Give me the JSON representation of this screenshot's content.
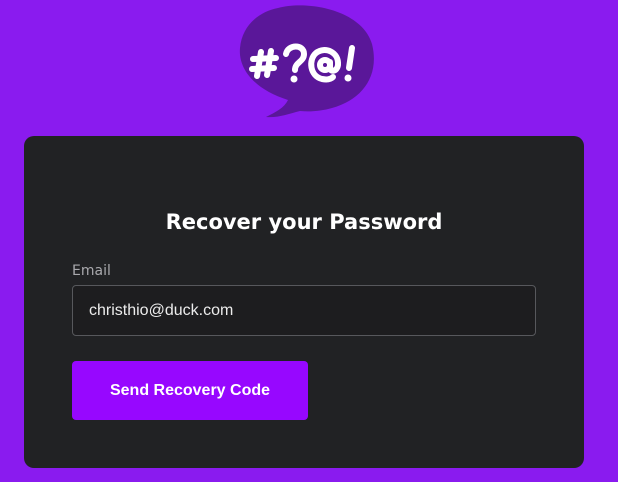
{
  "logo": {
    "text": "#?@!",
    "icon": "speech-bubble-logo",
    "bubble_color": "#5a1799"
  },
  "card": {
    "title": "Recover your Password",
    "email": {
      "label": "Email",
      "value": "christhio@duck.com"
    },
    "submit_label": "Send Recovery Code"
  },
  "colors": {
    "background": "#8a1bef",
    "card": "#212224",
    "accent": "#9707ff"
  }
}
